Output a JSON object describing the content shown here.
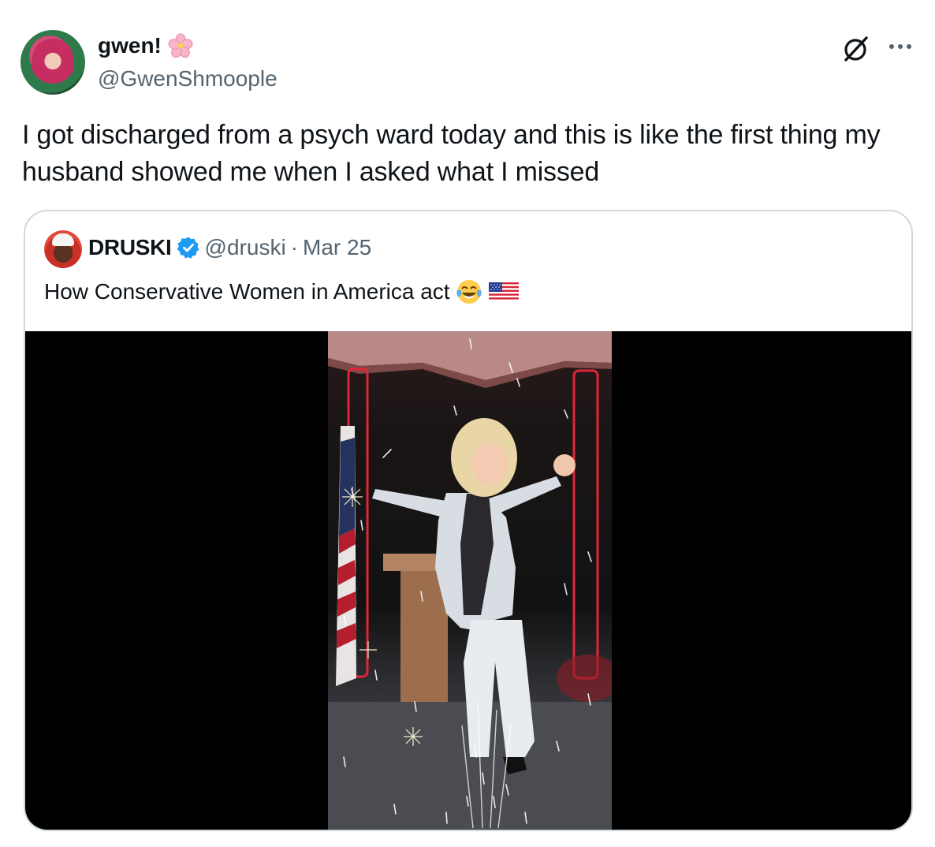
{
  "author": {
    "display_name": "gwen!",
    "handle": "@GwenShmoople",
    "name_emoji": "cherry-blossom-icon"
  },
  "tweet": {
    "text": "I got discharged from a psych ward today and this is like the first thing my husband showed me when I asked what I missed"
  },
  "quoted_tweet": {
    "display_name": "DRUSKI",
    "verified": true,
    "handle": "@druski",
    "separator": "·",
    "date": "Mar 25",
    "text": "How Conservative Women in America act",
    "emojis": [
      "face-with-tears-of-joy-icon",
      "us-flag-icon"
    ]
  },
  "colors": {
    "text_primary": "#0f1419",
    "text_secondary": "#536471",
    "border": "#cfd9de",
    "verified_blue": "#1d9bf0",
    "media_background": "#000000"
  }
}
